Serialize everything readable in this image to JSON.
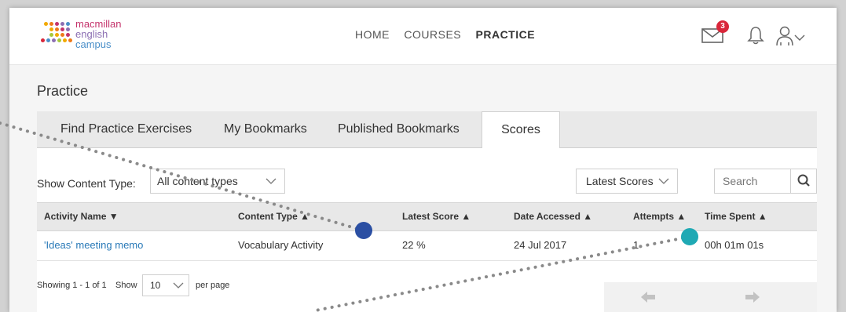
{
  "brand": {
    "line1": "macmillan",
    "line2": "english",
    "line3": "campus"
  },
  "nav": {
    "items": [
      "HOME",
      "COURSES",
      "PRACTICE"
    ],
    "active": "PRACTICE"
  },
  "header": {
    "mail_badge": "3"
  },
  "page": {
    "title": "Practice"
  },
  "tabs": [
    {
      "label": "Find Practice Exercises"
    },
    {
      "label": "My Bookmarks"
    },
    {
      "label": "Published Bookmarks"
    },
    {
      "label": "Scores",
      "active": true
    }
  ],
  "filters": {
    "content_type_label": "Show Content Type:",
    "content_type_value": "All content types",
    "scores_value": "Latest Scores",
    "search_placeholder": "Search"
  },
  "table": {
    "columns": [
      "Activity Name ▼",
      "Content Type ▲",
      "Latest Score ▲",
      "Date Accessed ▲",
      "Attempts ▲",
      "Time Spent ▲"
    ],
    "rows": [
      [
        "'Ideas' meeting memo",
        "Vocabulary Activity",
        "22 %",
        "24 Jul 2017",
        "1",
        "00h 01m 01s"
      ]
    ]
  },
  "footer": {
    "showing": "Showing 1 - 1 of 1",
    "show_label": "Show",
    "per_page_value": "10",
    "per_page_label": "per page"
  },
  "colors": {
    "accent_link": "#2a7ab8",
    "badge": "#d9263a",
    "marker_blue": "#2b4fa3",
    "marker_teal": "#1fa9b4",
    "dotted_line": "#8a8a8a"
  }
}
